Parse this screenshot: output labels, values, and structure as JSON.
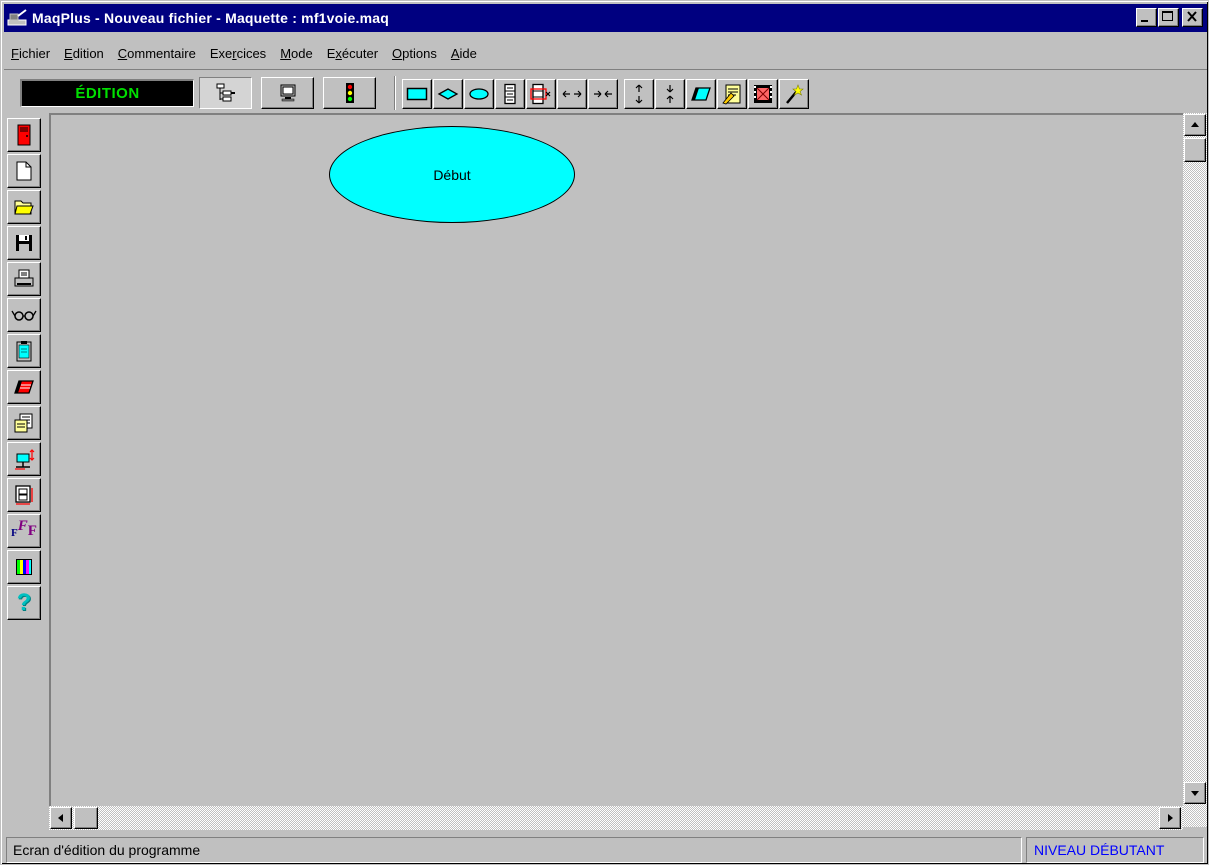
{
  "window": {
    "title": "MaqPlus - Nouveau fichier - Maquette : mf1voie.maq",
    "min_label": "_",
    "max_label": "□",
    "close_label": "×"
  },
  "menu": [
    {
      "pre": "",
      "ul": "F",
      "post": "ichier"
    },
    {
      "pre": "",
      "ul": "E",
      "post": "dition"
    },
    {
      "pre": "",
      "ul": "C",
      "post": "ommentaire"
    },
    {
      "pre": "Exe",
      "ul": "r",
      "post": "cices"
    },
    {
      "pre": "",
      "ul": "M",
      "post": "ode"
    },
    {
      "pre": "E",
      "ul": "x",
      "post": "écuter"
    },
    {
      "pre": "",
      "ul": "O",
      "post": "ptions"
    },
    {
      "pre": "",
      "ul": "A",
      "post": "ide"
    }
  ],
  "toolbar": {
    "mode": "ÉDITION",
    "mode_color": "#00e000",
    "icons": [
      "flowchart-icon",
      "monitor-icon",
      "traffic-light-icon",
      "rectangle-shape-icon",
      "diamond-shape-icon",
      "ellipse-shape-icon",
      "stack-icon",
      "stack-delete-icon",
      "widen-horizontal-icon",
      "narrow-horizontal-icon",
      "widen-vertical-icon",
      "narrow-vertical-icon",
      "eraser-icon",
      "document-edit-icon",
      "film-icon",
      "magic-wand-icon"
    ]
  },
  "lefttools": [
    "exit-door-icon",
    "new-file-icon",
    "open-folder-icon",
    "save-disk-icon",
    "print-icon",
    "preview-glasses-icon",
    "clipboard-icon",
    "delete-stack-icon",
    "copy-documents-icon",
    "resize-icon",
    "frame-resize-icon",
    "font-icon",
    "color-palette-icon",
    "help-icon"
  ],
  "font_label": "F",
  "help_label": "?",
  "canvas": {
    "node_label": "Début",
    "node_color": "#00ffff"
  },
  "status": {
    "message": "Ecran d'édition du programme",
    "level": "NIVEAU DÉBUTANT",
    "level_color": "#0000ff"
  }
}
